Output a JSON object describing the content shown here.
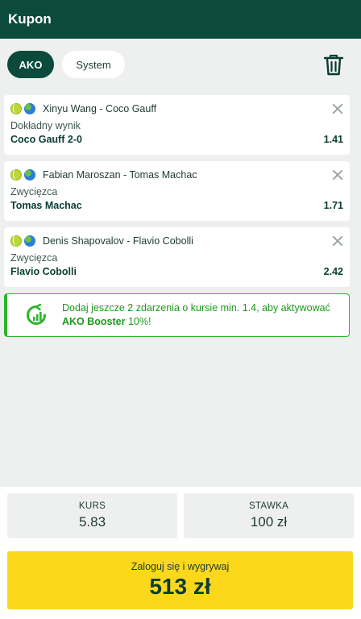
{
  "header": {
    "title": "Kupon"
  },
  "modes": {
    "active": "AKO",
    "other": "System"
  },
  "bets": [
    {
      "event": "Xinyu Wang - Coco Gauff",
      "market": "Dokładny wynik",
      "pick": "Coco Gauff 2-0",
      "odds": "1.41",
      "sport_icon": "tennis-ball-icon",
      "region_icon": "globe-icon"
    },
    {
      "event": "Fabian Maroszan - Tomas Machac",
      "market": "Zwycięzca",
      "pick": "Tomas Machac",
      "odds": "1.71",
      "sport_icon": "tennis-ball-icon",
      "region_icon": "globe-icon"
    },
    {
      "event": "Denis Shapovalov - Flavio Cobolli",
      "market": "Zwycięzca",
      "pick": "Flavio Cobolli",
      "odds": "2.42",
      "sport_icon": "tennis-ball-icon",
      "region_icon": "globe-icon"
    }
  ],
  "booster": {
    "text_before": "Dodaj jeszcze 2 zdarzenia o kursie min. 1.4, aby aktywować ",
    "highlight": "AKO Booster",
    "text_after": " 10%!",
    "icon": "booster-icon"
  },
  "summary": {
    "odds_label": "KURS",
    "odds_value": "5.83",
    "stake_label": "STAWKA",
    "stake_value": "100 zł",
    "cta_label": "Zaloguj się i wygrywaj",
    "cta_amount": "513 zł"
  },
  "colors": {
    "brand_dark": "#0b4a3c",
    "accent_yellow": "#fcd81d",
    "booster_green": "#2bb52b"
  }
}
